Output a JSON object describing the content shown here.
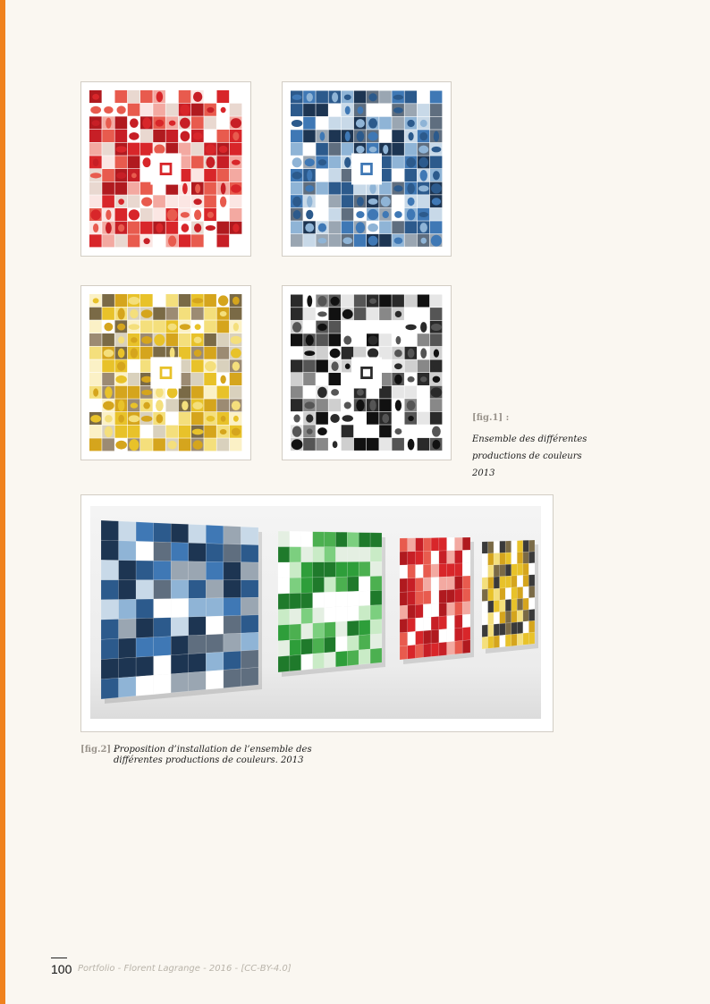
{
  "fig1": {
    "tag": "[fig.1] :",
    "text": "Ensemble des différentes productions de couleurs 2013"
  },
  "fig2": {
    "tag": "[fig.2] :",
    "text": "Proposition d’installation de l’ensemble des différentes productions de couleurs. 2013"
  },
  "footer": {
    "page_number": "100",
    "text": "Portfolio - Florent Lagrange - 2016 - [CC-BY-4.0]"
  },
  "colors": {
    "accent_bar": "#f0821e",
    "red": "#d8262a",
    "blue": "#3f78b5",
    "yellow": "#e8c22a",
    "black": "#2a2a2a",
    "green": "#2e9e3a"
  },
  "mosaics": [
    {
      "id": "red-mosaic",
      "palette": [
        "#d8262a",
        "#c71f26",
        "#e85b4e",
        "#f3a9a1",
        "#fbe6e3",
        "#b01a1f",
        "#ffffff",
        "#e9d8d0"
      ]
    },
    {
      "id": "blue-mosaic",
      "palette": [
        "#3f78b5",
        "#2c5a8c",
        "#8fb4d6",
        "#1d3552",
        "#c8d9e8",
        "#5f6e7f",
        "#ffffff",
        "#9aa6b2"
      ]
    },
    {
      "id": "yellow-mosaic",
      "palette": [
        "#e8c22a",
        "#d5a51d",
        "#f4df7c",
        "#7a6a46",
        "#fbf1c6",
        "#9c8b73",
        "#ffffff",
        "#d9d1bd"
      ]
    },
    {
      "id": "black-mosaic",
      "palette": [
        "#2a2a2a",
        "#111111",
        "#555555",
        "#888888",
        "#cfcfcf",
        "#ffffff",
        "#ffffff",
        "#e6e6e6"
      ]
    }
  ]
}
